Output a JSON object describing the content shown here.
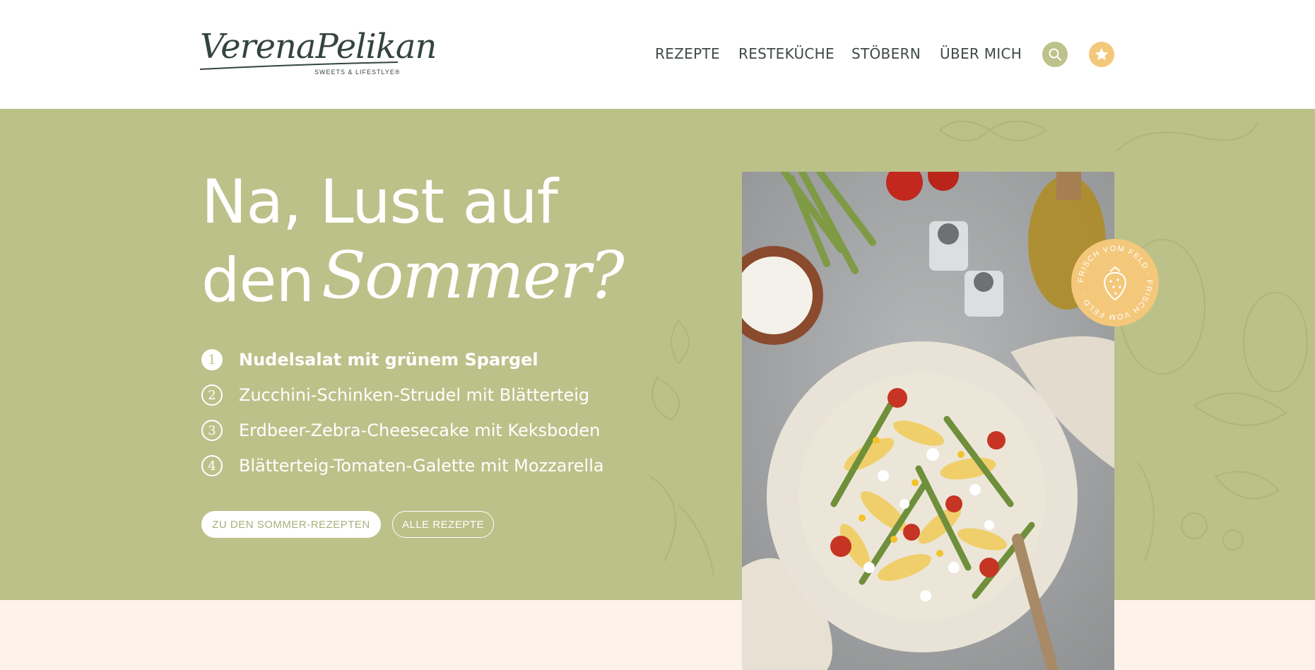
{
  "header": {
    "logo": {
      "script": "VerenaPelikan",
      "tagline": "SWEETS & LIFESTLYE®"
    },
    "nav": [
      "REZEPTE",
      "RESTEKÜCHE",
      "STÖBERN",
      "ÜBER MICH"
    ],
    "icons": {
      "search": "search-icon",
      "favorites": "star-icon"
    }
  },
  "hero": {
    "title_line1": "Na, Lust auf",
    "title_line2_plain": "den",
    "title_line2_script": "Sommer?",
    "list": [
      {
        "num": "1",
        "label": "Nudelsalat mit grünem Spargel"
      },
      {
        "num": "2",
        "label": "Zucchini-Schinken-Strudel mit Blätterteig"
      },
      {
        "num": "3",
        "label": "Erdbeer-Zebra-Cheesecake mit Keksboden"
      },
      {
        "num": "4",
        "label": "Blätterteig-Tomaten-Galette mit Mozzarella"
      }
    ],
    "buttons": {
      "primary": "ZU DEN SOMMER-REZEPTEN",
      "secondary": "ALLE REZEPTE"
    },
    "badge": {
      "text": "FRISCH VOM FELD · FRISCH VOM FELD ·",
      "icon": "strawberry-icon"
    }
  },
  "colors": {
    "hero_green": "#bcc189",
    "accent_yellow": "#f4c87b",
    "text_dark": "#3f4a45",
    "cream": "#fdf3eb"
  }
}
